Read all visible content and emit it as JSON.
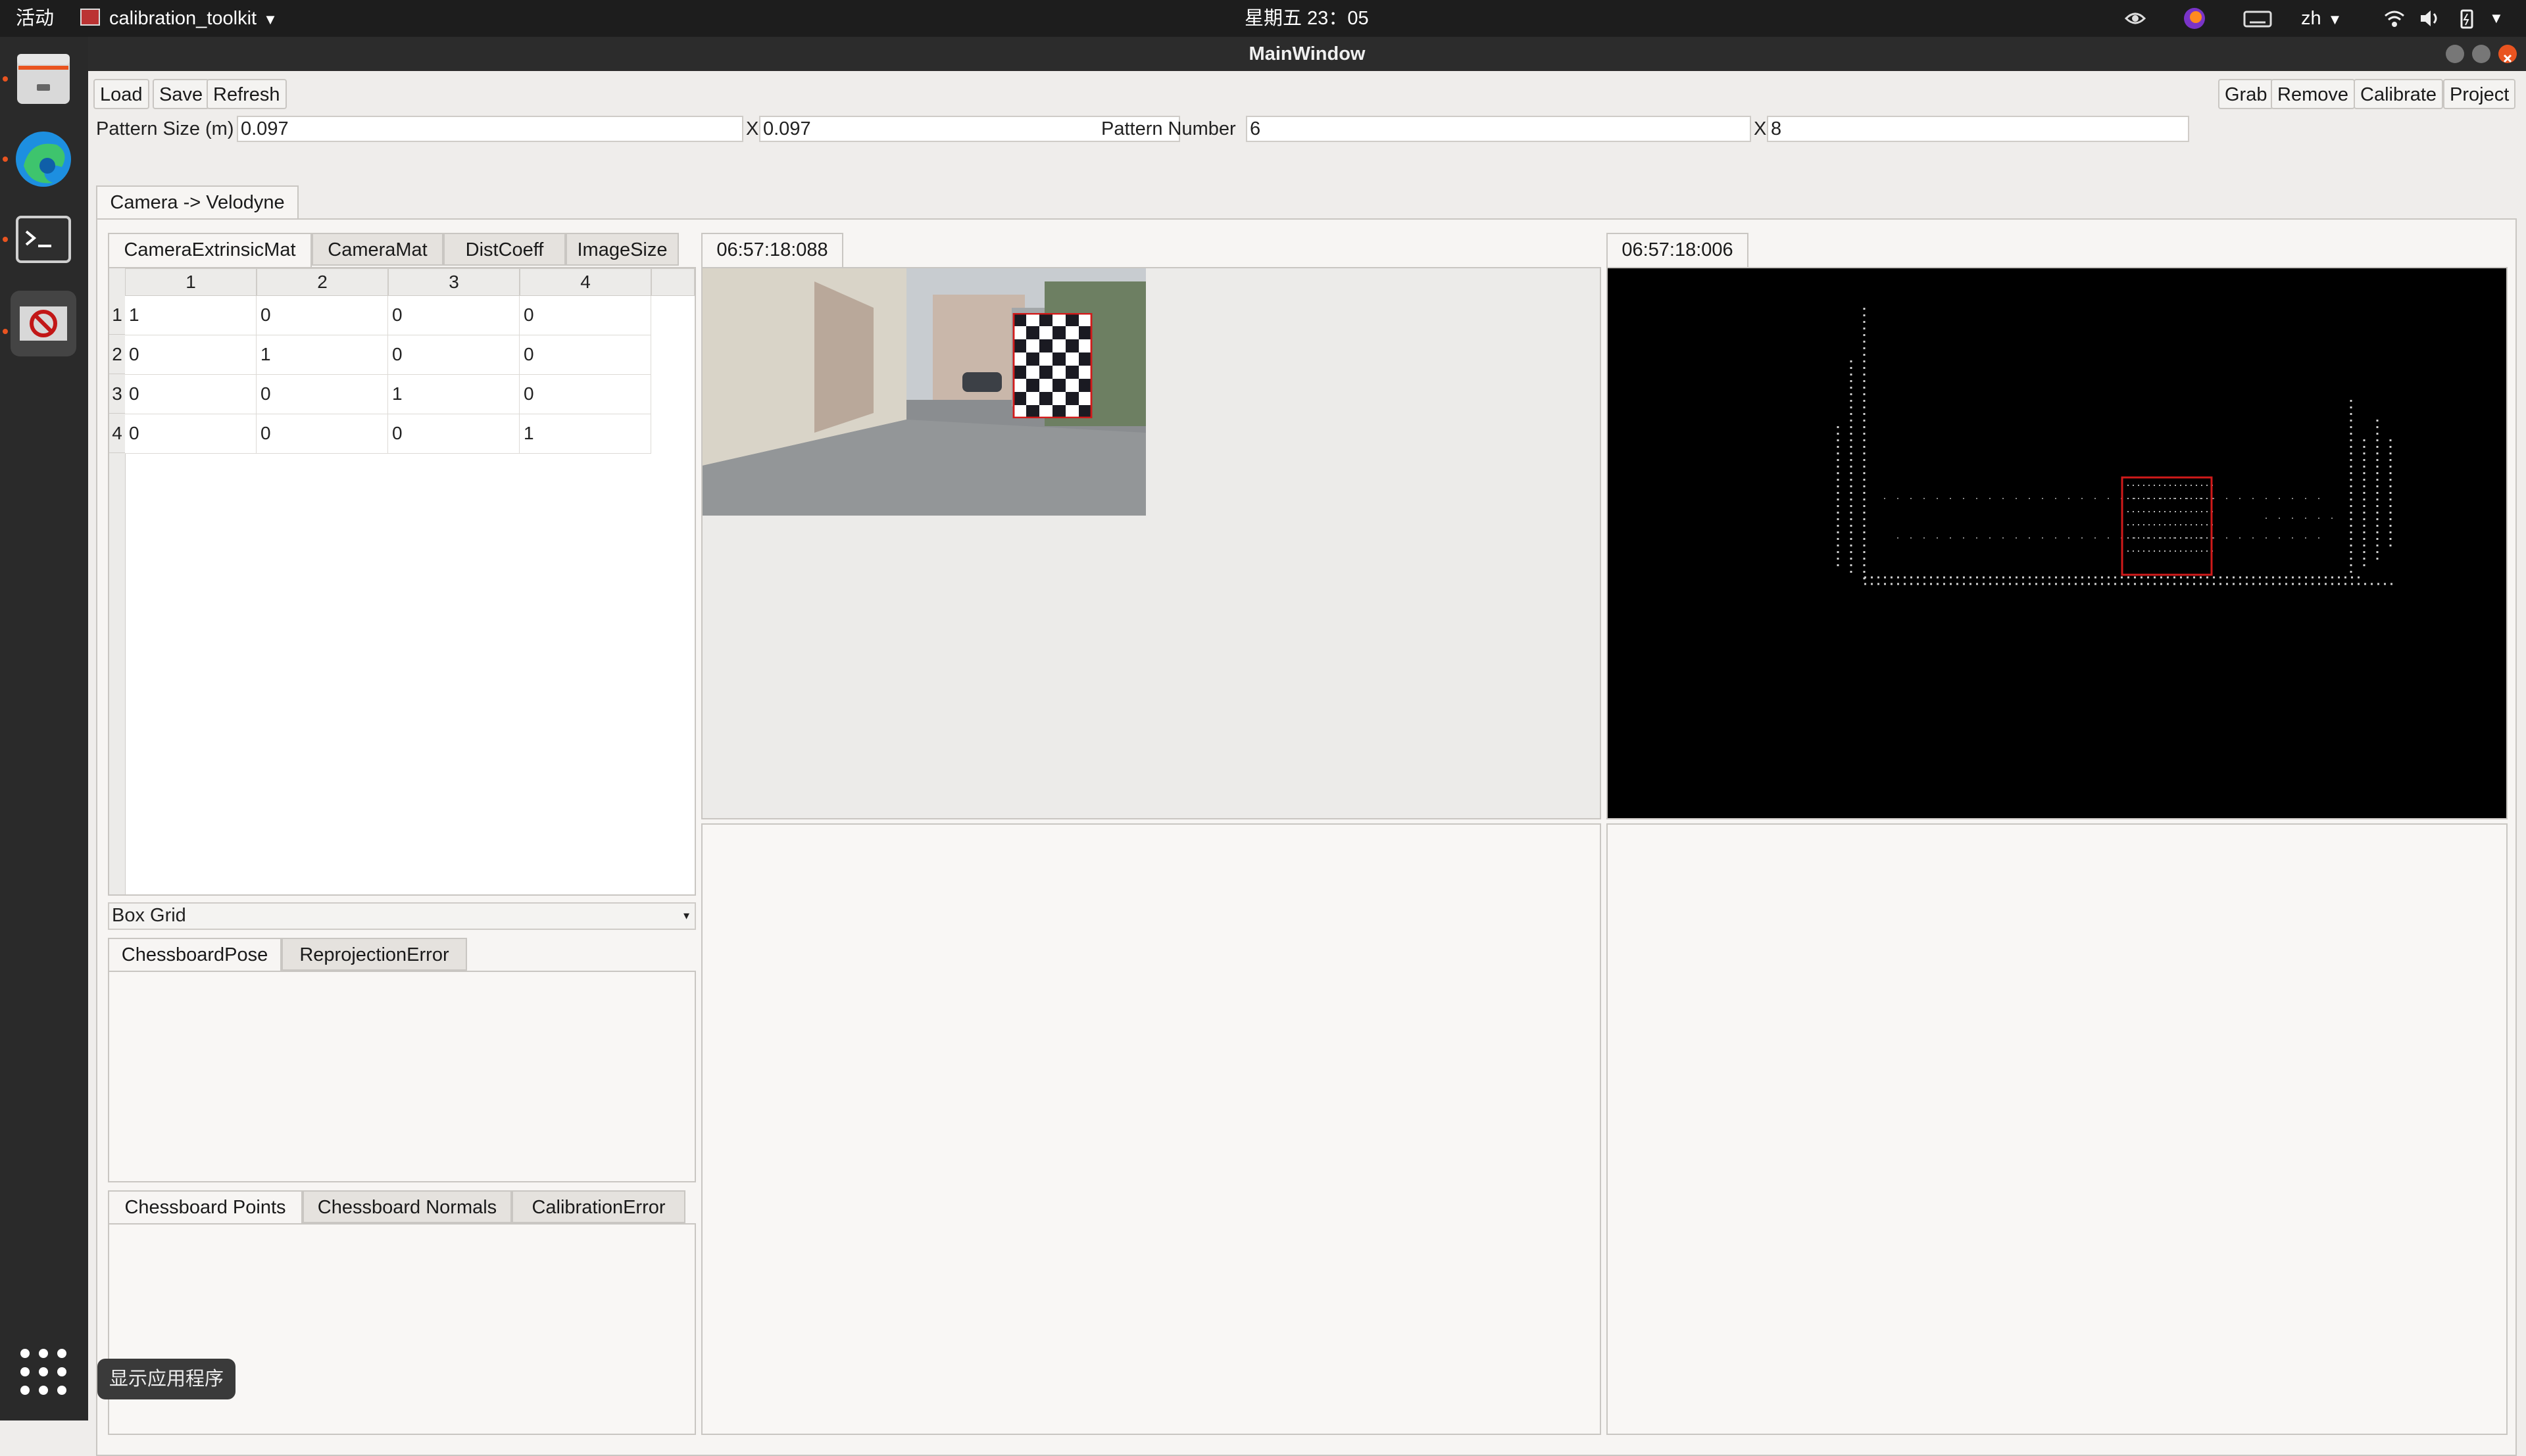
{
  "system": {
    "activities": "活动",
    "app_menu": "calibration_toolkit",
    "clock": "星期五 23：05",
    "lang": "zh",
    "show_apps_tooltip": "显示应用程序"
  },
  "window": {
    "title": "MainWindow"
  },
  "toolbar": {
    "load": "Load",
    "save": "Save",
    "refresh": "Refresh",
    "grab": "Grab",
    "remove": "Remove",
    "calibrate": "Calibrate",
    "project": "Project"
  },
  "params": {
    "pattern_size_label": "Pattern Size (m)",
    "pattern_size_x": "0.097",
    "x_label": "X",
    "pattern_size_y": "0.097",
    "pattern_number_label": "Pattern Number",
    "pattern_number_x": "6",
    "pattern_number_y": "8"
  },
  "main_tab": "Camera -> Velodyne",
  "left_tabs": [
    "CameraExtrinsicMat",
    "CameraMat",
    "DistCoeff",
    "ImageSize"
  ],
  "matrix": {
    "col_headers": [
      "1",
      "2",
      "3",
      "4"
    ],
    "row_headers": [
      "1",
      "2",
      "3",
      "4"
    ],
    "rows": [
      [
        "1",
        "0",
        "0",
        "0"
      ],
      [
        "0",
        "1",
        "0",
        "0"
      ],
      [
        "0",
        "0",
        "1",
        "0"
      ],
      [
        "0",
        "0",
        "0",
        "1"
      ]
    ]
  },
  "box_grid": "Box Grid",
  "pose_tabs": [
    "ChessboardPose",
    "ReprojectionError"
  ],
  "points_tabs": [
    "Chessboard Points",
    "Chessboard Normals",
    "CalibrationError"
  ],
  "camera_view": {
    "timestamp": "06:57:18:088"
  },
  "lidar_view": {
    "timestamp": "06:57:18:006"
  },
  "colors": {
    "accent": "#e95420",
    "lidar_bg": "#000000",
    "highlight": "#d11a1a"
  }
}
